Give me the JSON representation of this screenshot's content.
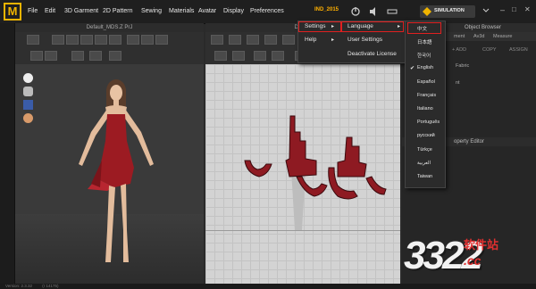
{
  "app": {
    "logo": "M",
    "file_title": "IND_2015"
  },
  "menubar": [
    "File",
    "Edit",
    "3D Garment",
    "2D Pattern",
    "Sewing",
    "Materials",
    "Avatar",
    "Display",
    "Preferences"
  ],
  "simulation_label": "SIMULATION",
  "pane3d": {
    "title": "Default_MDS.Z PrJ"
  },
  "pane2d": {
    "title": "Default"
  },
  "right_panel": {
    "header": "Object Browser",
    "tabs": [
      "ment",
      "Av3d",
      "Measure"
    ],
    "tools": [
      "+ ADD",
      "COPY",
      "ASSIGN"
    ],
    "rows": [
      "Fabric",
      "nt"
    ],
    "property_header": "operty Editor"
  },
  "settings_menu": {
    "items": [
      {
        "label": "Settings",
        "arrow": "▸"
      },
      {
        "label": "Help",
        "arrow": "▸"
      }
    ],
    "sub_items": [
      "Language",
      "User Settings",
      "Deactivate License"
    ],
    "language_arrow": "▸"
  },
  "language_menu": {
    "options": [
      "中文",
      "日本語",
      "한국어",
      "English",
      "Español",
      "Français",
      "Italiano",
      "Português",
      "русский",
      "Türkçe",
      "العربية",
      "Taiwan"
    ],
    "checked": "English"
  },
  "status_bar": {
    "version": "Version: 2.3.32",
    "revision": "(r 14175)"
  },
  "watermark": {
    "digits": "3322",
    "cn": "软件站",
    "domain": ".cc"
  },
  "colors": {
    "accent": "#f0b400",
    "dress": "#9c1b22",
    "highlight": "#e02020"
  }
}
